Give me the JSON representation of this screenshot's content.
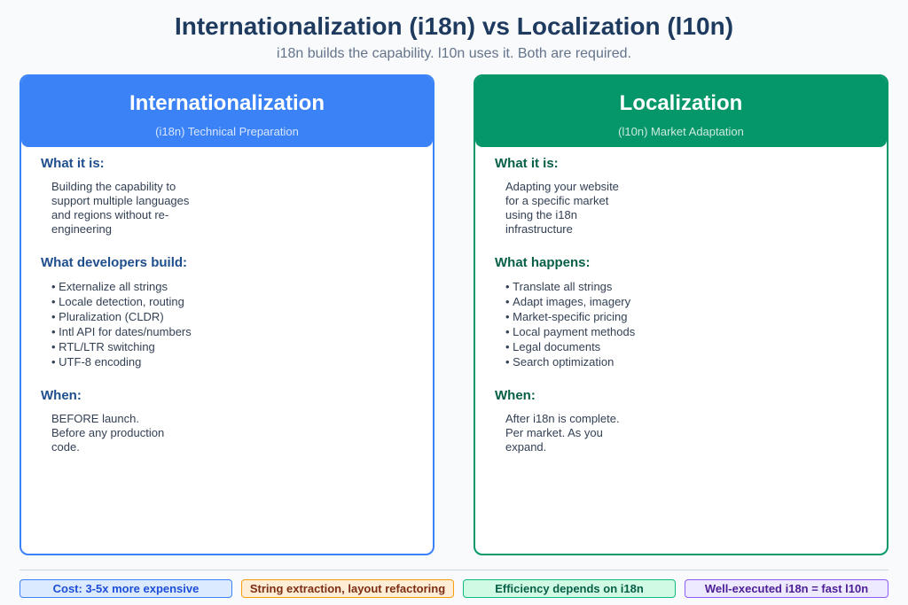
{
  "header": {
    "title": "Internationalization (i18n) vs Localization (l10n)",
    "subtitle": "i18n builds the capability. l10n uses it. Both are required."
  },
  "left": {
    "title": "Internationalization",
    "subtitle": "(i18n) Technical Preparation",
    "s1_label": "What it is:",
    "s1_text": "Building the capability to support multiple languages and regions without re-engineering",
    "s2_label": "What developers build:",
    "s2_items": [
      "Externalize all strings",
      "Locale detection, routing",
      "Pluralization (CLDR)",
      "Intl API for dates/numbers",
      "RTL/LTR switching",
      "UTF-8 encoding"
    ],
    "s3_label": "When:",
    "s3_text": "BEFORE launch. Before any production code."
  },
  "right": {
    "title": "Localization",
    "subtitle": "(l10n) Market Adaptation",
    "s1_label": "What it is:",
    "s1_text": "Adapting your website for a specific market using the i18n infrastructure",
    "s2_label": "What happens:",
    "s2_items": [
      "Translate all strings",
      "Adapt images, imagery",
      "Market-specific pricing",
      "Local payment methods",
      "Legal documents",
      "Search optimization"
    ],
    "s3_label": "When:",
    "s3_text": "After i18n is complete. Per market. As you expand."
  },
  "footer": {
    "badges": [
      "Cost: 3-5x more expensive",
      "String extraction, layout refactoring",
      "Efficiency depends on i18n",
      "Well-executed i18n = fast l10n"
    ]
  },
  "colors": {
    "i18n_accent": "#3b82f6",
    "l10n_accent": "#059669",
    "title": "#1e3a5f"
  }
}
